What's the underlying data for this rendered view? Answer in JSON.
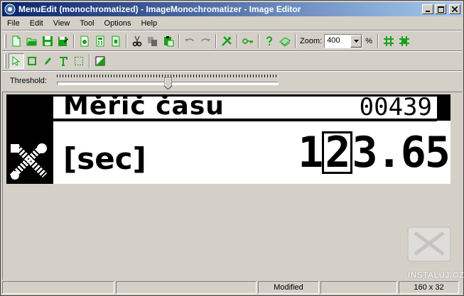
{
  "window": {
    "title": "MenuEdit (monochromatized) - ImageMonochromatizer - Image Editor"
  },
  "menu": [
    "File",
    "Edit",
    "View",
    "Tool",
    "Options",
    "Help"
  ],
  "toolbar": {
    "zoom_label": "Zoom:",
    "zoom_value": "400",
    "zoom_unit": "%"
  },
  "threshold": {
    "label": "Threshold:",
    "level": 0.5
  },
  "image": {
    "title": "Měřič času",
    "counter": "00439",
    "unit": "[sec]",
    "value_before": "1",
    "value_highlight": "2",
    "value_after": "3.65"
  },
  "status": {
    "cell1": "",
    "cell2": "",
    "modified": "Modified",
    "cell4": "",
    "dimensions": "160 x 32"
  },
  "watermark": {
    "text": "INSTALUJ.CZ"
  },
  "colors": {
    "title_start": "#0a246a",
    "title_end": "#a6caf0",
    "face": "#d4d0c8",
    "icon_green": "#18a018"
  }
}
